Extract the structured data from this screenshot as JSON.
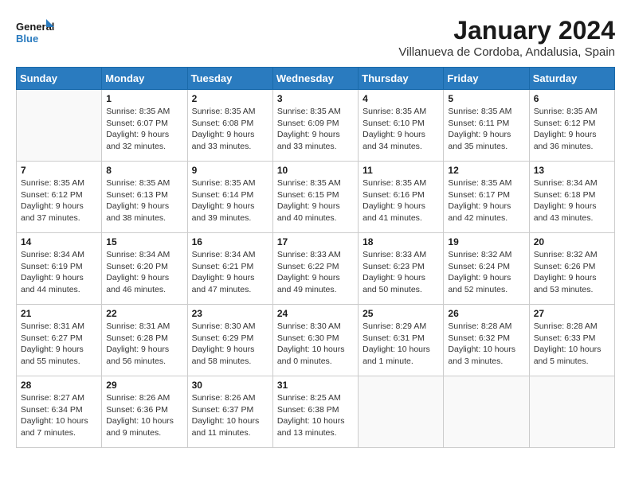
{
  "logo": {
    "line1": "General",
    "line2": "Blue"
  },
  "title": "January 2024",
  "subtitle": "Villanueva de Cordoba, Andalusia, Spain",
  "weekdays": [
    "Sunday",
    "Monday",
    "Tuesday",
    "Wednesday",
    "Thursday",
    "Friday",
    "Saturday"
  ],
  "weeks": [
    [
      {
        "day": "",
        "info": ""
      },
      {
        "day": "1",
        "info": "Sunrise: 8:35 AM\nSunset: 6:07 PM\nDaylight: 9 hours\nand 32 minutes."
      },
      {
        "day": "2",
        "info": "Sunrise: 8:35 AM\nSunset: 6:08 PM\nDaylight: 9 hours\nand 33 minutes."
      },
      {
        "day": "3",
        "info": "Sunrise: 8:35 AM\nSunset: 6:09 PM\nDaylight: 9 hours\nand 33 minutes."
      },
      {
        "day": "4",
        "info": "Sunrise: 8:35 AM\nSunset: 6:10 PM\nDaylight: 9 hours\nand 34 minutes."
      },
      {
        "day": "5",
        "info": "Sunrise: 8:35 AM\nSunset: 6:11 PM\nDaylight: 9 hours\nand 35 minutes."
      },
      {
        "day": "6",
        "info": "Sunrise: 8:35 AM\nSunset: 6:12 PM\nDaylight: 9 hours\nand 36 minutes."
      }
    ],
    [
      {
        "day": "7",
        "info": "Sunrise: 8:35 AM\nSunset: 6:12 PM\nDaylight: 9 hours\nand 37 minutes."
      },
      {
        "day": "8",
        "info": "Sunrise: 8:35 AM\nSunset: 6:13 PM\nDaylight: 9 hours\nand 38 minutes."
      },
      {
        "day": "9",
        "info": "Sunrise: 8:35 AM\nSunset: 6:14 PM\nDaylight: 9 hours\nand 39 minutes."
      },
      {
        "day": "10",
        "info": "Sunrise: 8:35 AM\nSunset: 6:15 PM\nDaylight: 9 hours\nand 40 minutes."
      },
      {
        "day": "11",
        "info": "Sunrise: 8:35 AM\nSunset: 6:16 PM\nDaylight: 9 hours\nand 41 minutes."
      },
      {
        "day": "12",
        "info": "Sunrise: 8:35 AM\nSunset: 6:17 PM\nDaylight: 9 hours\nand 42 minutes."
      },
      {
        "day": "13",
        "info": "Sunrise: 8:34 AM\nSunset: 6:18 PM\nDaylight: 9 hours\nand 43 minutes."
      }
    ],
    [
      {
        "day": "14",
        "info": "Sunrise: 8:34 AM\nSunset: 6:19 PM\nDaylight: 9 hours\nand 44 minutes."
      },
      {
        "day": "15",
        "info": "Sunrise: 8:34 AM\nSunset: 6:20 PM\nDaylight: 9 hours\nand 46 minutes."
      },
      {
        "day": "16",
        "info": "Sunrise: 8:34 AM\nSunset: 6:21 PM\nDaylight: 9 hours\nand 47 minutes."
      },
      {
        "day": "17",
        "info": "Sunrise: 8:33 AM\nSunset: 6:22 PM\nDaylight: 9 hours\nand 49 minutes."
      },
      {
        "day": "18",
        "info": "Sunrise: 8:33 AM\nSunset: 6:23 PM\nDaylight: 9 hours\nand 50 minutes."
      },
      {
        "day": "19",
        "info": "Sunrise: 8:32 AM\nSunset: 6:24 PM\nDaylight: 9 hours\nand 52 minutes."
      },
      {
        "day": "20",
        "info": "Sunrise: 8:32 AM\nSunset: 6:26 PM\nDaylight: 9 hours\nand 53 minutes."
      }
    ],
    [
      {
        "day": "21",
        "info": "Sunrise: 8:31 AM\nSunset: 6:27 PM\nDaylight: 9 hours\nand 55 minutes."
      },
      {
        "day": "22",
        "info": "Sunrise: 8:31 AM\nSunset: 6:28 PM\nDaylight: 9 hours\nand 56 minutes."
      },
      {
        "day": "23",
        "info": "Sunrise: 8:30 AM\nSunset: 6:29 PM\nDaylight: 9 hours\nand 58 minutes."
      },
      {
        "day": "24",
        "info": "Sunrise: 8:30 AM\nSunset: 6:30 PM\nDaylight: 10 hours\nand 0 minutes."
      },
      {
        "day": "25",
        "info": "Sunrise: 8:29 AM\nSunset: 6:31 PM\nDaylight: 10 hours\nand 1 minute."
      },
      {
        "day": "26",
        "info": "Sunrise: 8:28 AM\nSunset: 6:32 PM\nDaylight: 10 hours\nand 3 minutes."
      },
      {
        "day": "27",
        "info": "Sunrise: 8:28 AM\nSunset: 6:33 PM\nDaylight: 10 hours\nand 5 minutes."
      }
    ],
    [
      {
        "day": "28",
        "info": "Sunrise: 8:27 AM\nSunset: 6:34 PM\nDaylight: 10 hours\nand 7 minutes."
      },
      {
        "day": "29",
        "info": "Sunrise: 8:26 AM\nSunset: 6:36 PM\nDaylight: 10 hours\nand 9 minutes."
      },
      {
        "day": "30",
        "info": "Sunrise: 8:26 AM\nSunset: 6:37 PM\nDaylight: 10 hours\nand 11 minutes."
      },
      {
        "day": "31",
        "info": "Sunrise: 8:25 AM\nSunset: 6:38 PM\nDaylight: 10 hours\nand 13 minutes."
      },
      {
        "day": "",
        "info": ""
      },
      {
        "day": "",
        "info": ""
      },
      {
        "day": "",
        "info": ""
      }
    ]
  ]
}
